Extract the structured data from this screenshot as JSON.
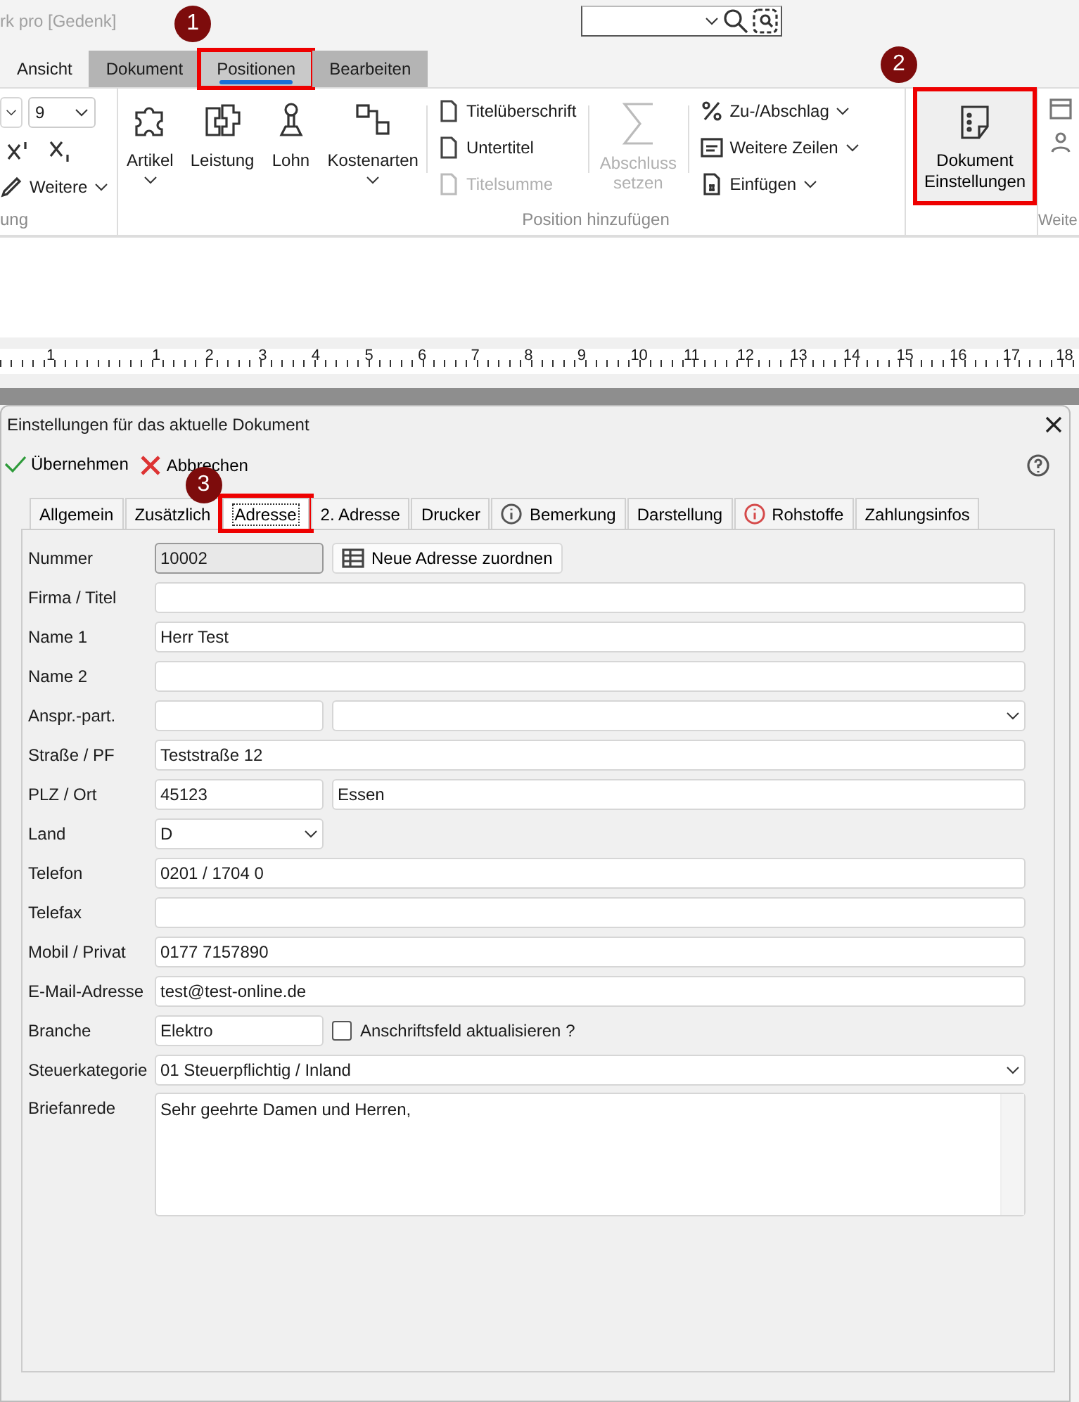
{
  "window": {
    "title": "rk pro [Gedenk]"
  },
  "ribbon_tabs": [
    {
      "label": "Ansicht",
      "selected": false
    },
    {
      "label": "Dokument",
      "selected": false
    },
    {
      "label": "Positionen",
      "selected": true,
      "callout": "1"
    },
    {
      "label": "Bearbeiten",
      "selected": false
    }
  ],
  "ribbon": {
    "font_size": "9",
    "more": "Weitere",
    "left_group_label": "ung",
    "big_buttons": [
      {
        "label": "Artikel",
        "dropdown": true
      },
      {
        "label": "Leistung",
        "dropdown": false
      },
      {
        "label": "Lohn",
        "dropdown": false
      },
      {
        "label": "Kostenarten",
        "dropdown": true
      }
    ],
    "title_buttons": [
      {
        "label": "Titelüberschrift",
        "disabled": false
      },
      {
        "label": "Untertitel",
        "disabled": false
      },
      {
        "label": "Titelsumme",
        "disabled": true
      }
    ],
    "sum_button": {
      "label": "Abschluss setzen",
      "disabled": true
    },
    "menu_buttons": [
      {
        "label": "Zu-/Abschlag"
      },
      {
        "label": "Weitere Zeilen"
      },
      {
        "label": "Einfügen"
      }
    ],
    "group_label": "Position hinzufügen",
    "settings_button": {
      "label": "Dokument Einstellungen",
      "callout": "2"
    },
    "right_group_label": "Weite"
  },
  "ruler": {
    "labels": [
      "1",
      "1",
      "2",
      "3",
      "4",
      "5",
      "6",
      "7",
      "8",
      "9",
      "10",
      "11",
      "12",
      "13",
      "14",
      "15",
      "16",
      "17",
      "18"
    ]
  },
  "dialog": {
    "title": "Einstellungen für das aktuelle Dokument",
    "actions": [
      {
        "label": "Übernehmen",
        "kind": "apply"
      },
      {
        "label": "Abbrechen",
        "kind": "cancel"
      }
    ],
    "tabs": [
      {
        "label": "Allgemein",
        "selected": false
      },
      {
        "label": "Zusätzlich",
        "selected": false
      },
      {
        "label": "Adresse",
        "selected": true,
        "callout": "3"
      },
      {
        "label": "2. Adresse",
        "selected": false
      },
      {
        "label": "Drucker",
        "selected": false
      },
      {
        "label": "Bemerkung",
        "selected": false,
        "info": true,
        "alert": false
      },
      {
        "label": "Darstellung",
        "selected": false
      },
      {
        "label": "Rohstoffe",
        "selected": false,
        "info": true,
        "alert": true
      },
      {
        "label": "Zahlungsinfos",
        "selected": false
      }
    ],
    "rows": [
      {
        "label": "Nummer",
        "kind": "readonly",
        "value": "10002",
        "button": "Neue Adresse zuordnen"
      },
      {
        "label": "Firma / Titel",
        "kind": "text"
      },
      {
        "label": "Name 1",
        "kind": "text",
        "value": "Herr Test"
      },
      {
        "label": "Name 2",
        "kind": "text"
      },
      {
        "label": "Anspr.-part.",
        "kind": "split-combo"
      },
      {
        "label": "Straße / PF",
        "kind": "text",
        "value": "Teststraße 12"
      },
      {
        "label": "PLZ / Ort",
        "kind": "split",
        "value": "45123",
        "value2": "Essen"
      },
      {
        "label": "Land",
        "kind": "short-combo",
        "value": "D"
      },
      {
        "label": "Telefon",
        "kind": "text",
        "value": "0201 / 1704 0"
      },
      {
        "label": "Telefax",
        "kind": "text"
      },
      {
        "label": "Mobil / Privat",
        "kind": "text",
        "value": "0177 7157890"
      },
      {
        "label": "E-Mail-Adresse",
        "kind": "text",
        "value": "test@test-online.de"
      },
      {
        "label": "Branche",
        "kind": "check",
        "value": "Elektro",
        "check_label": "Anschriftsfeld aktualisieren ?",
        "checked": false
      },
      {
        "label": "Steuerkategorie",
        "kind": "combo",
        "value": "01 Steuerpflichtig / Inland"
      },
      {
        "label": "Briefanrede",
        "kind": "textarea",
        "value": "Sehr geehrte Damen und Herren,"
      }
    ]
  }
}
